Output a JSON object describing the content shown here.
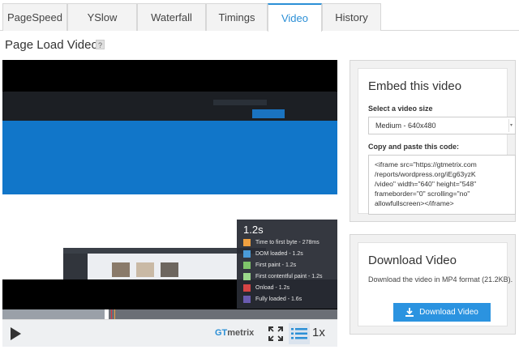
{
  "tabs": [
    {
      "label": "PageSpeed"
    },
    {
      "label": "YSlow"
    },
    {
      "label": "Waterfall"
    },
    {
      "label": "Timings"
    },
    {
      "label": "Video"
    },
    {
      "label": "History"
    }
  ],
  "active_tab": "Video",
  "page": {
    "title": "Page Load Video",
    "help_label": "?"
  },
  "player": {
    "time_display": "1.2s",
    "timings": [
      {
        "label": "Time to first byte - 278ms",
        "color": "#f0a040"
      },
      {
        "label": "DOM loaded - 1.2s",
        "color": "#4a9bd8"
      },
      {
        "label": "First paint - 1.2s",
        "color": "#7fc46a"
      },
      {
        "label": "First contentful paint - 1.2s",
        "color": "#9bd88a"
      },
      {
        "label": "Onload - 1.2s",
        "color": "#d64545"
      },
      {
        "label": "Fully loaded - 1.6s",
        "color": "#6a5bb0"
      }
    ],
    "progress_fraction": 0.31,
    "brand_prefix": "GT",
    "brand_suffix": "metrix",
    "speed": "1x"
  },
  "embed": {
    "title": "Embed this video",
    "size_label": "Select a video size",
    "size_value": "Medium - 640x480",
    "code_label": "Copy and paste this code:",
    "code": "<iframe src=\"https://gtmetrix.com\n/reports/wordpress.org/iEg63yzK\n/video\" width=\"640\" height=\"548\"\nframeborder=\"0\" scrolling=\"no\"\nallowfullscreen></iframe>"
  },
  "download": {
    "title": "Download Video",
    "description": "Download the video in MP4 format (21.2KB).",
    "button_label": "Download Video"
  },
  "colors": {
    "accent": "#2b8fd6",
    "button": "#2b93e0"
  }
}
